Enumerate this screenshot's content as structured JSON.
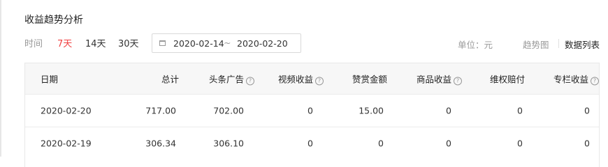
{
  "title": "收益趋势分析",
  "filters": {
    "time_label": "时间",
    "range_7": "7天",
    "range_14": "14天",
    "range_30": "30天"
  },
  "date_range": {
    "start": "2020-02-14",
    "separator": "~",
    "end": "2020-02-20"
  },
  "unit": "单位：元",
  "views": {
    "trend": "趋势图",
    "list": "数据列表"
  },
  "columns": {
    "date": "日期",
    "total": "总计",
    "toutiao_ads": "头条广告",
    "video": "视频收益",
    "tips": "赞赏金额",
    "goods": "商品收益",
    "rights": "维权赔付",
    "column": "专栏收益"
  },
  "rows": [
    {
      "date": "2020-02-20",
      "total": "717.00",
      "toutiao_ads": "702.00",
      "video": "0",
      "tips": "15.00",
      "goods": "0",
      "rights": "0",
      "column": "0"
    },
    {
      "date": "2020-02-19",
      "total": "306.34",
      "toutiao_ads": "306.10",
      "video": "0",
      "tips": "0",
      "goods": "0",
      "rights": "0",
      "column": "0"
    }
  ],
  "colors": {
    "accent": "#f04142",
    "muted": "#999999",
    "header_bg": "#f7f7f7",
    "border": "#e8e8e8"
  }
}
